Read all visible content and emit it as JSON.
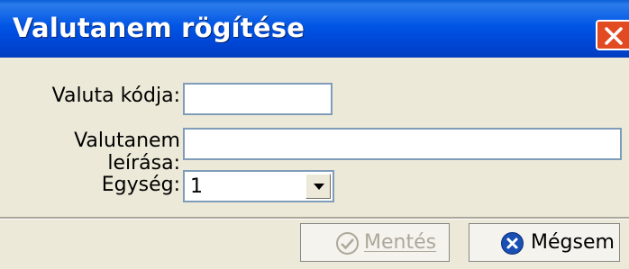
{
  "window": {
    "title": "Valutanem rögítése"
  },
  "form": {
    "code_label": "Valuta kódja:",
    "code_value": "",
    "description_label": "Valutanem leírása:",
    "description_value": "",
    "unit_label": "Egység:",
    "unit_value": "1"
  },
  "buttons": {
    "save_label": "Mentés",
    "cancel_label": "Mégsem"
  },
  "colors": {
    "titlebar": "#0055E5",
    "close": "#E24A22",
    "background": "#ECE9D8",
    "input_border": "#7F9DB9",
    "cancel_icon": "#1A4FB4"
  },
  "icons": {
    "close": "close-icon",
    "save": "checkmark-circle-icon",
    "cancel": "x-circle-icon",
    "dropdown": "chevron-down-icon"
  }
}
